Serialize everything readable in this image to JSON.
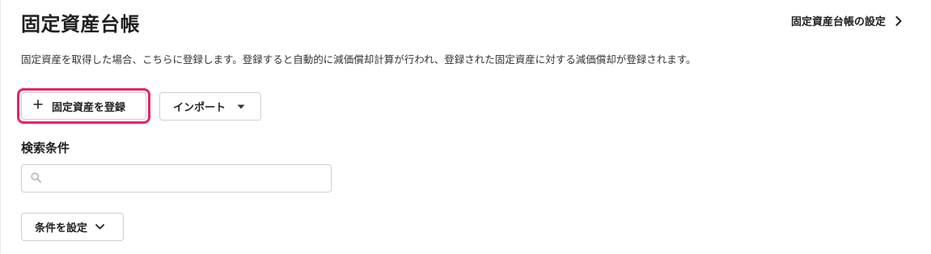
{
  "header": {
    "title": "固定資産台帳",
    "settings_link_label": "固定資産台帳の設定"
  },
  "description": "固定資産を取得した場合、こちらに登録します。登録すると自動的に減価償却計算が行われ、登録された固定資産に対する減価償却が登録されます。",
  "actions": {
    "register_label": "固定資産を登録",
    "import_label": "インポート"
  },
  "search": {
    "section_label": "検索条件",
    "value": "",
    "placeholder": "",
    "conditions_label": "条件を設定"
  },
  "colors": {
    "highlight": "#e8255f",
    "border": "#cfcfcf",
    "text": "#1f1f1f"
  }
}
